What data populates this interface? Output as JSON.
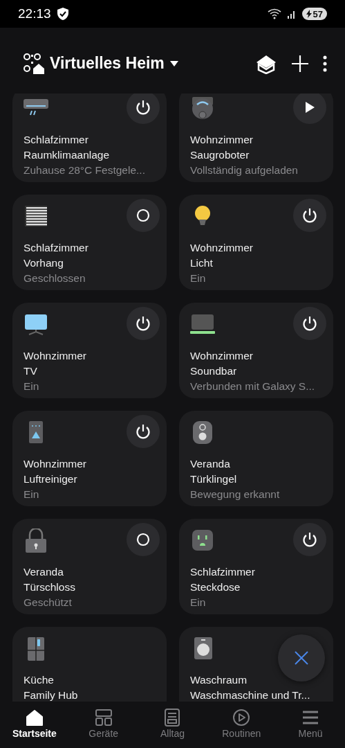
{
  "status_bar": {
    "time": "22:13",
    "battery": "57"
  },
  "header": {
    "title": "Virtuelles Heim"
  },
  "devices": [
    {
      "kind": "ac",
      "room": "Schlafzimmer",
      "name": "Raumklimaanlage",
      "status": "Zuhause 28°C Festgele..."
    },
    {
      "kind": "robot",
      "room": "Wohnzimmer",
      "name": "Saugroboter",
      "status": "Vollständig aufgeladen"
    },
    {
      "kind": "blind",
      "room": "Schlafzimmer",
      "name": "Vorhang",
      "status": "Geschlossen"
    },
    {
      "kind": "bulb",
      "room": "Wohnzimmer",
      "name": "Licht",
      "status": "Ein"
    },
    {
      "kind": "tv",
      "room": "Wohnzimmer",
      "name": "TV",
      "status": "Ein"
    },
    {
      "kind": "soundbar",
      "room": "Wohnzimmer",
      "name": "Soundbar",
      "status": "Verbunden mit Galaxy S..."
    },
    {
      "kind": "purifier",
      "room": "Wohnzimmer",
      "name": "Luftreiniger",
      "status": "Ein"
    },
    {
      "kind": "doorbell",
      "room": "Veranda",
      "name": "Türklingel",
      "status": "Bewegung erkannt"
    },
    {
      "kind": "lock",
      "room": "Veranda",
      "name": "Türschloss",
      "status": "Geschützt"
    },
    {
      "kind": "plug",
      "room": "Schlafzimmer",
      "name": "Steckdose",
      "status": "Ein"
    },
    {
      "kind": "fridge",
      "room": "Küche",
      "name": "Family Hub"
    },
    {
      "kind": "washer",
      "room": "Waschraum",
      "name": "Waschmaschine und Tr..."
    }
  ],
  "bottom_nav": [
    {
      "label": "Startseite",
      "selected": true
    },
    {
      "label": "Geräte",
      "selected": false
    },
    {
      "label": "Alltag",
      "selected": false
    },
    {
      "label": "Routinen",
      "selected": false
    },
    {
      "label": "Menü",
      "selected": false
    }
  ]
}
